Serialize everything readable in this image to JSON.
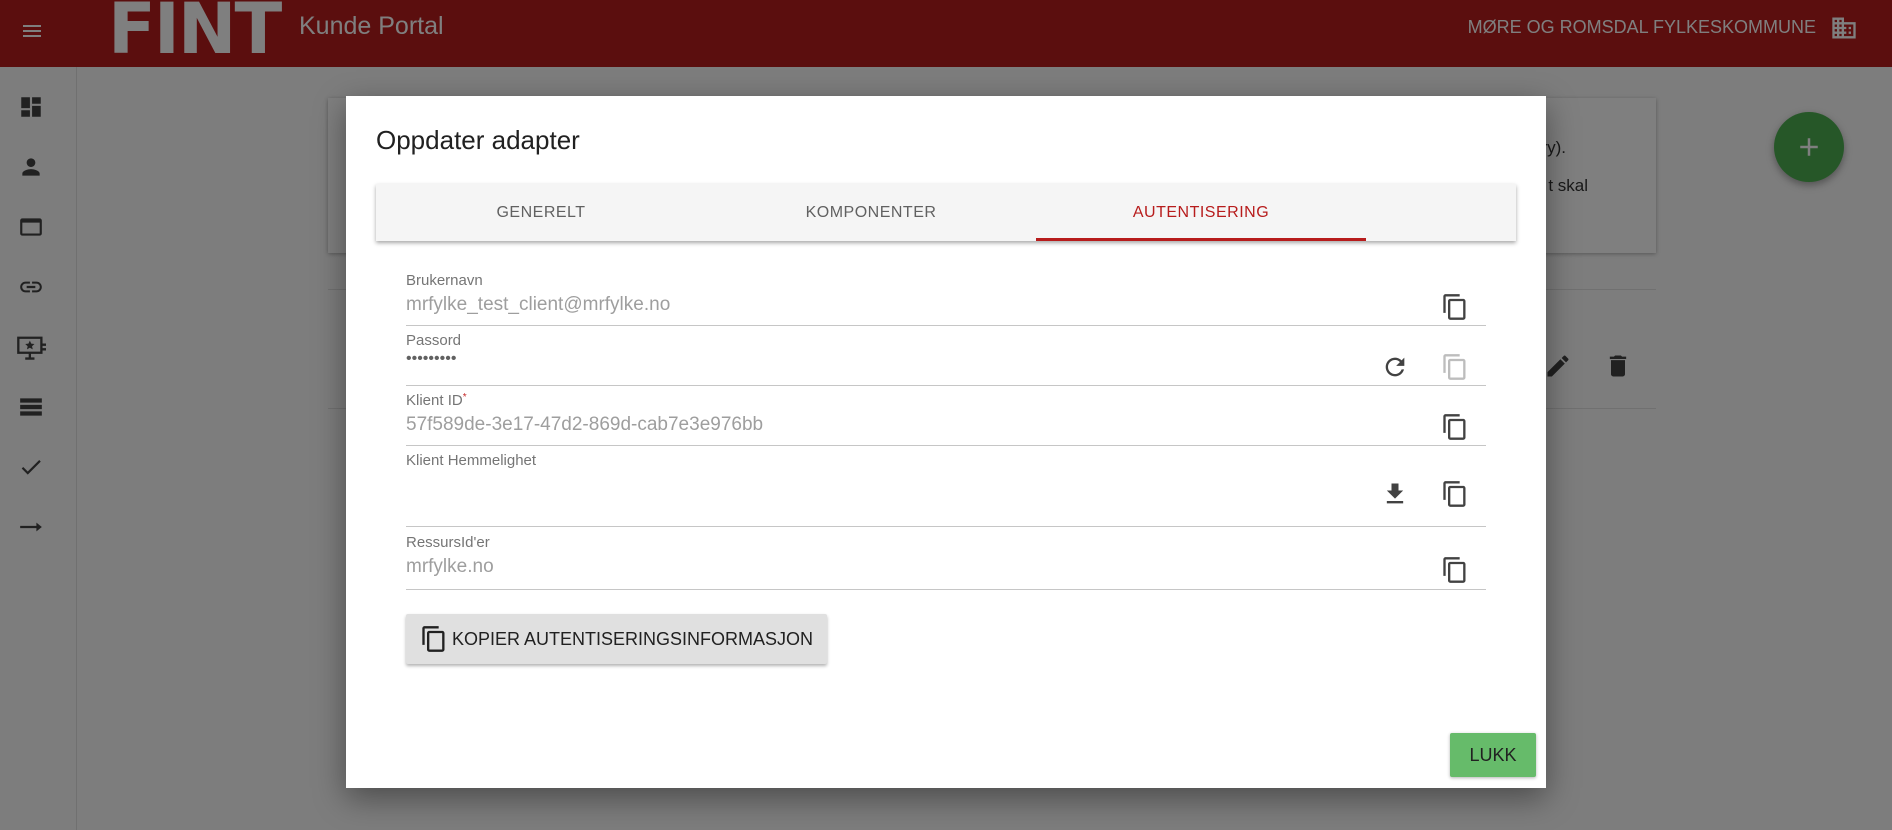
{
  "header": {
    "logo": "FINT",
    "title": "Kunde Portal",
    "organization": "MØRE OG ROMSDAL FYLKESKOMMUNE",
    "menu_icon": "menu-icon",
    "org_icon": "building-icon"
  },
  "sidebar": {
    "items": [
      {
        "icon": "dashboard-icon"
      },
      {
        "icon": "person-icon"
      },
      {
        "icon": "web-icon"
      },
      {
        "icon": "link-icon"
      },
      {
        "icon": "monitor-star-icon"
      },
      {
        "icon": "list-icon"
      },
      {
        "icon": "check-icon"
      },
      {
        "icon": "arrow-right-icon"
      }
    ]
  },
  "background": {
    "info_line1": "vry).",
    "info_line2": "t skal",
    "fab_icon": "add-icon"
  },
  "dialog": {
    "title": "Oppdater adapter",
    "tabs": [
      {
        "label": "GENERELT",
        "active": false
      },
      {
        "label": "KOMPONENTER",
        "active": false
      },
      {
        "label": "AUTENTISERING",
        "active": true
      }
    ],
    "fields": {
      "username": {
        "label": "Brukernavn",
        "value": "mrfylke_test_client@mrfylke.no"
      },
      "password": {
        "label": "Passord",
        "value": "•••••••••"
      },
      "client_id": {
        "label": "Klient ID",
        "required_mark": "*",
        "value": "57f589de-3e17-47d2-869d-cab7e3e976bb"
      },
      "client_secret": {
        "label": "Klient Hemmelighet",
        "value": ""
      },
      "resource_ids": {
        "label": "RessursId'er",
        "value": "mrfylke.no"
      }
    },
    "copy_all_label": "KOPIER AUTENTISERINGSINFORMASJON",
    "close_label": "LUKK"
  },
  "colors": {
    "primary": "#b71c1c",
    "accent_green": "#4caf50",
    "close_green": "#66bb6a"
  }
}
